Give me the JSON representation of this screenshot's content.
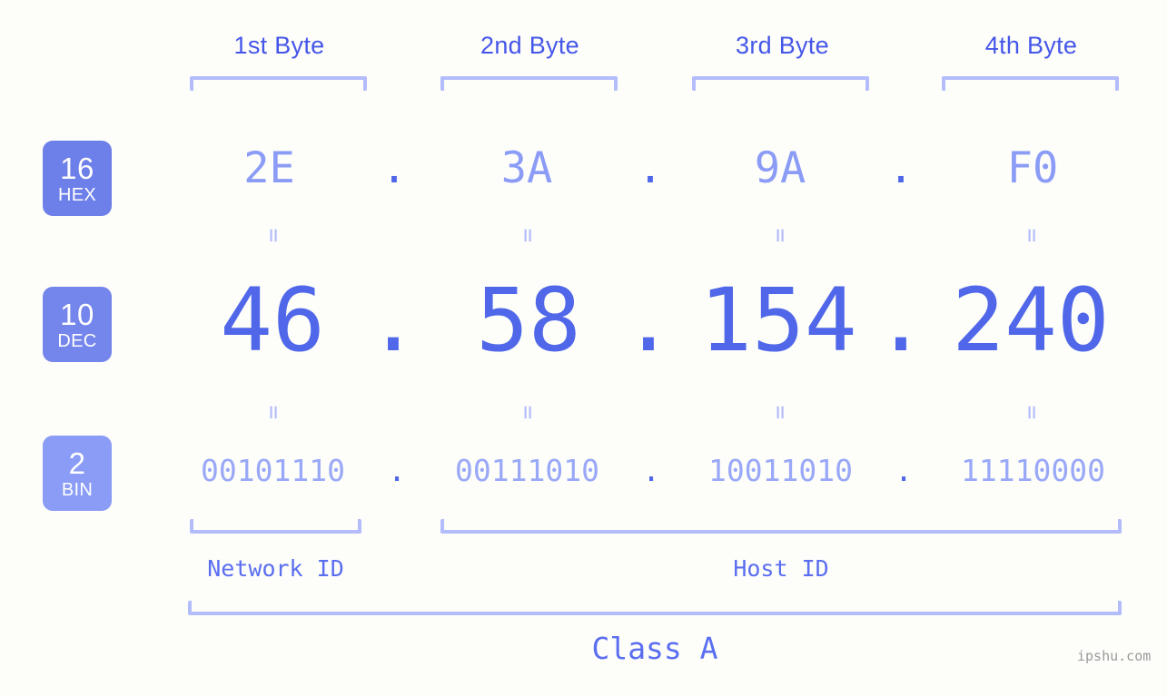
{
  "page": {
    "background_color": "#fdfdfa",
    "watermark": "ipshu.com"
  },
  "colors": {
    "byte_label": "#4557e8",
    "bracket": "#b4bdfb",
    "hex_value": "#8b9cf6",
    "dec_value": "#4f67e8",
    "bin_value": "#99a8f7",
    "dot": "#4f67e8",
    "badge_hex": "#6d7fe8",
    "badge_dec": "#7486ec",
    "badge_bin": "#8b9cf6",
    "id_label": "#5a6ef0",
    "watermark": "#9a9a9a"
  },
  "byte_headers": [
    {
      "label": "1st Byte"
    },
    {
      "label": "2nd Byte"
    },
    {
      "label": "3rd Byte"
    },
    {
      "label": "4th Byte"
    }
  ],
  "bases": [
    {
      "number": "16",
      "name": "HEX"
    },
    {
      "number": "10",
      "name": "DEC"
    },
    {
      "number": "2",
      "name": "BIN"
    }
  ],
  "separator": {
    "dot": ".",
    "equals": "="
  },
  "rows": {
    "hex": {
      "base_number": "16",
      "base_name": "HEX",
      "octets": [
        "2E",
        "3A",
        "9A",
        "F0"
      ]
    },
    "dec": {
      "base_number": "10",
      "base_name": "DEC",
      "octets": [
        "46",
        "58",
        "154",
        "240"
      ]
    },
    "bin": {
      "base_number": "2",
      "base_name": "BIN",
      "octets": [
        "00101110",
        "00111010",
        "10011010",
        "11110000"
      ]
    }
  },
  "ip_address": {
    "hex": "2E.3A.9A.F0",
    "dec": "46.58.154.240",
    "bin": "00101110.00111010.10011010.11110000"
  },
  "segments": {
    "network_id": "Network ID",
    "host_id": "Host ID",
    "class": "Class A"
  }
}
